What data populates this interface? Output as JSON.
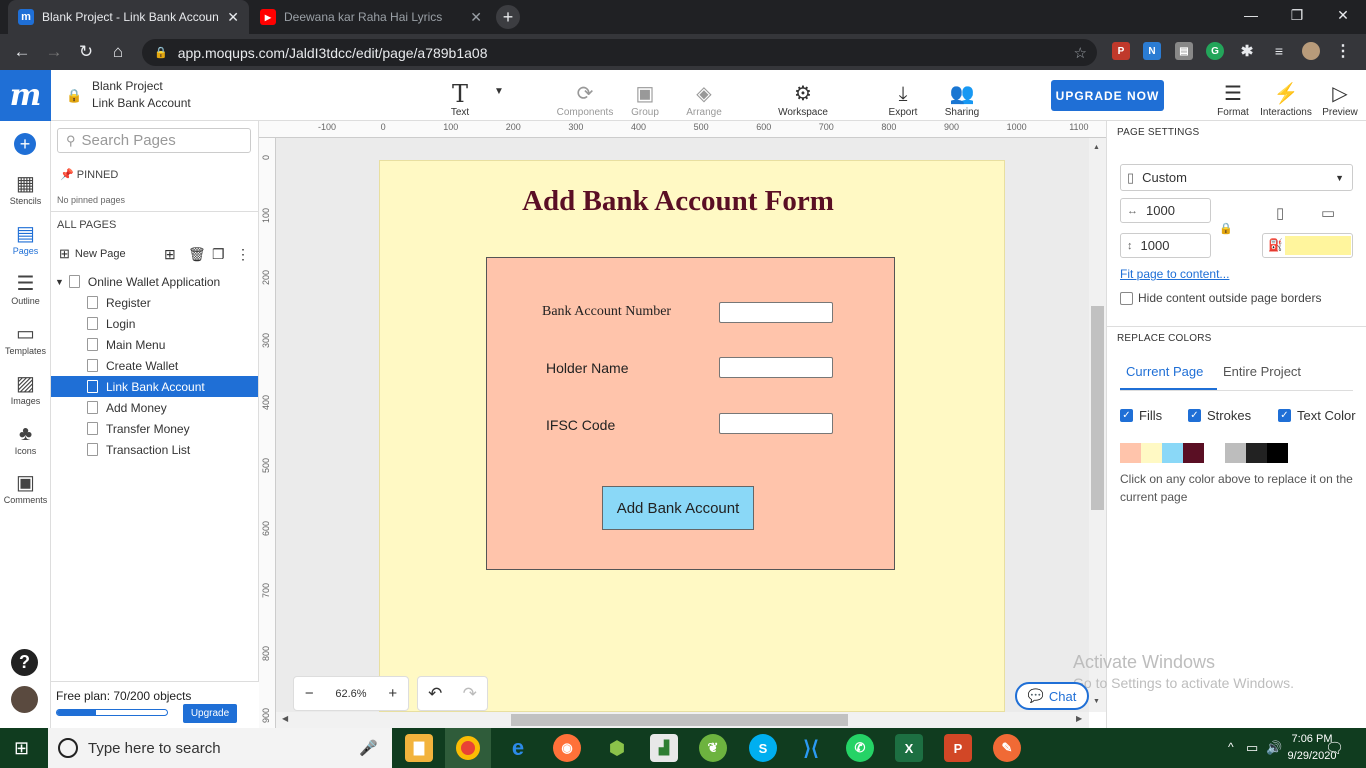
{
  "browser": {
    "tabs": [
      {
        "title": "Blank Project - Link Bank Accoun",
        "favicon": "m",
        "favicon_color": "#1f6fd6",
        "active": true
      },
      {
        "title": "Deewana kar Raha Hai Lyrics",
        "favicon": "▶",
        "favicon_color": "#ff0000",
        "active": false
      }
    ],
    "url": "app.moqups.com/JaldI3tdcc/edit/page/a789b1a08"
  },
  "app": {
    "logo": "m",
    "project_name": "Blank Project",
    "page_name": "Link Bank Account",
    "toolbar": [
      {
        "label": "Text",
        "icon": "text-icon"
      },
      {
        "label": "Components",
        "icon": "components-icon"
      },
      {
        "label": "Group",
        "icon": "group-icon"
      },
      {
        "label": "Arrange",
        "icon": "arrange-icon"
      },
      {
        "label": "Workspace",
        "icon": "workspace-icon"
      },
      {
        "label": "Export",
        "icon": "export-icon"
      },
      {
        "label": "Sharing",
        "icon": "sharing-icon"
      }
    ],
    "upgrade_label": "UPGRADE NOW",
    "right_tools": [
      {
        "label": "Format",
        "icon": "format-icon"
      },
      {
        "label": "Interactions",
        "icon": "interactions-icon"
      },
      {
        "label": "Preview",
        "icon": "preview-icon"
      }
    ]
  },
  "rail": [
    {
      "label": "Stencils"
    },
    {
      "label": "Pages"
    },
    {
      "label": "Outline"
    },
    {
      "label": "Templates"
    },
    {
      "label": "Images"
    },
    {
      "label": "Icons"
    },
    {
      "label": "Comments"
    }
  ],
  "pages_panel": {
    "search_placeholder": "Search Pages",
    "pinned_label": "PINNED",
    "no_pinned": "No pinned pages",
    "all_pages_label": "ALL PAGES",
    "new_page_label": "New Page",
    "folder": "Online Wallet Application",
    "pages": [
      "Register",
      "Login",
      "Main Menu",
      "Create Wallet",
      "Link Bank Account",
      "Add Money",
      "Transfer Money",
      "Transaction List"
    ],
    "selected_page": "Link Bank Account",
    "plan_text": "Free plan: 70/200 objects",
    "plan_fraction": 0.35,
    "plan_upgrade": "Upgrade"
  },
  "rulers": {
    "top": [
      "-100",
      "0",
      "100",
      "200",
      "300",
      "400",
      "500",
      "600",
      "700",
      "800",
      "900",
      "1000",
      "1100"
    ],
    "left": [
      "0",
      "100",
      "200",
      "300",
      "400",
      "500",
      "600",
      "700",
      "800",
      "900"
    ]
  },
  "form": {
    "title": "Add Bank Account Form",
    "fields": [
      {
        "label": "Bank Account Number",
        "value": ""
      },
      {
        "label": "Holder Name",
        "value": ""
      },
      {
        "label": "IFSC Code",
        "value": ""
      }
    ],
    "button": "Add Bank Account",
    "colors": {
      "page": "#fff9c4",
      "form": "#ffc4ab",
      "title": "#5a0f24",
      "button": "#8ad8f7"
    }
  },
  "zoom": {
    "minus": "−",
    "value": "62.6%",
    "plus": "+"
  },
  "right_panel": {
    "page_settings": "PAGE SETTINGS",
    "size_preset": "Custom",
    "width": "1000",
    "height": "1000",
    "fit_link": "Fit page to content...",
    "hide_outside": "Hide content outside page borders",
    "replace_colors": "REPLACE COLORS",
    "tabs": [
      "Current Page",
      "Entire Project"
    ],
    "checks": [
      "Fills",
      "Strokes",
      "Text Color"
    ],
    "swatches": [
      "#ffc4ab",
      "#fff9c4",
      "#8ad8f7",
      "#5a0f24",
      "#ffffff",
      "#bdbdbd",
      "#222222",
      "#000000"
    ],
    "hint": "Click on any color above to replace it on the current page",
    "bg_color": "#fff59d"
  },
  "watermark": {
    "title": "Activate Windows",
    "subtitle": "Go to Settings to activate Windows."
  },
  "chat_label": "Chat",
  "taskbar": {
    "search_placeholder": "Type here to search",
    "time": "7:06 PM",
    "date": "9/29/2020"
  }
}
